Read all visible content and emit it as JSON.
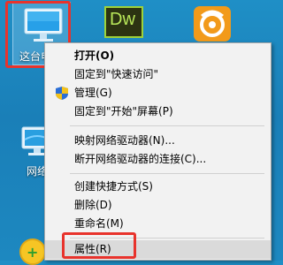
{
  "desktop": {
    "icons": [
      {
        "label": "这台电",
        "name": "this-pc"
      },
      {
        "label": "Dw",
        "name": "dreamweaver"
      },
      {
        "label": "",
        "name": "uc-browser"
      },
      {
        "label": "网络",
        "name": "network"
      }
    ]
  },
  "menu": {
    "items": [
      {
        "label": "打开(O)",
        "bold": true
      },
      {
        "label": "固定到\"快速访问\""
      },
      {
        "label": "管理(G)",
        "icon": "shield-icon"
      },
      {
        "label": "固定到\"开始\"屏幕(P)"
      },
      {
        "label": "映射网络驱动器(N)..."
      },
      {
        "label": "断开网络驱动器的连接(C)..."
      },
      {
        "label": "创建快捷方式(S)"
      },
      {
        "label": "删除(D)"
      },
      {
        "label": "重命名(M)"
      },
      {
        "label": "属性(R)",
        "hover": true
      }
    ]
  },
  "colors": {
    "desktop_bg": "#1a7fb8",
    "menu_bg": "#f2f2f2",
    "highlight_red": "#e8332c"
  }
}
